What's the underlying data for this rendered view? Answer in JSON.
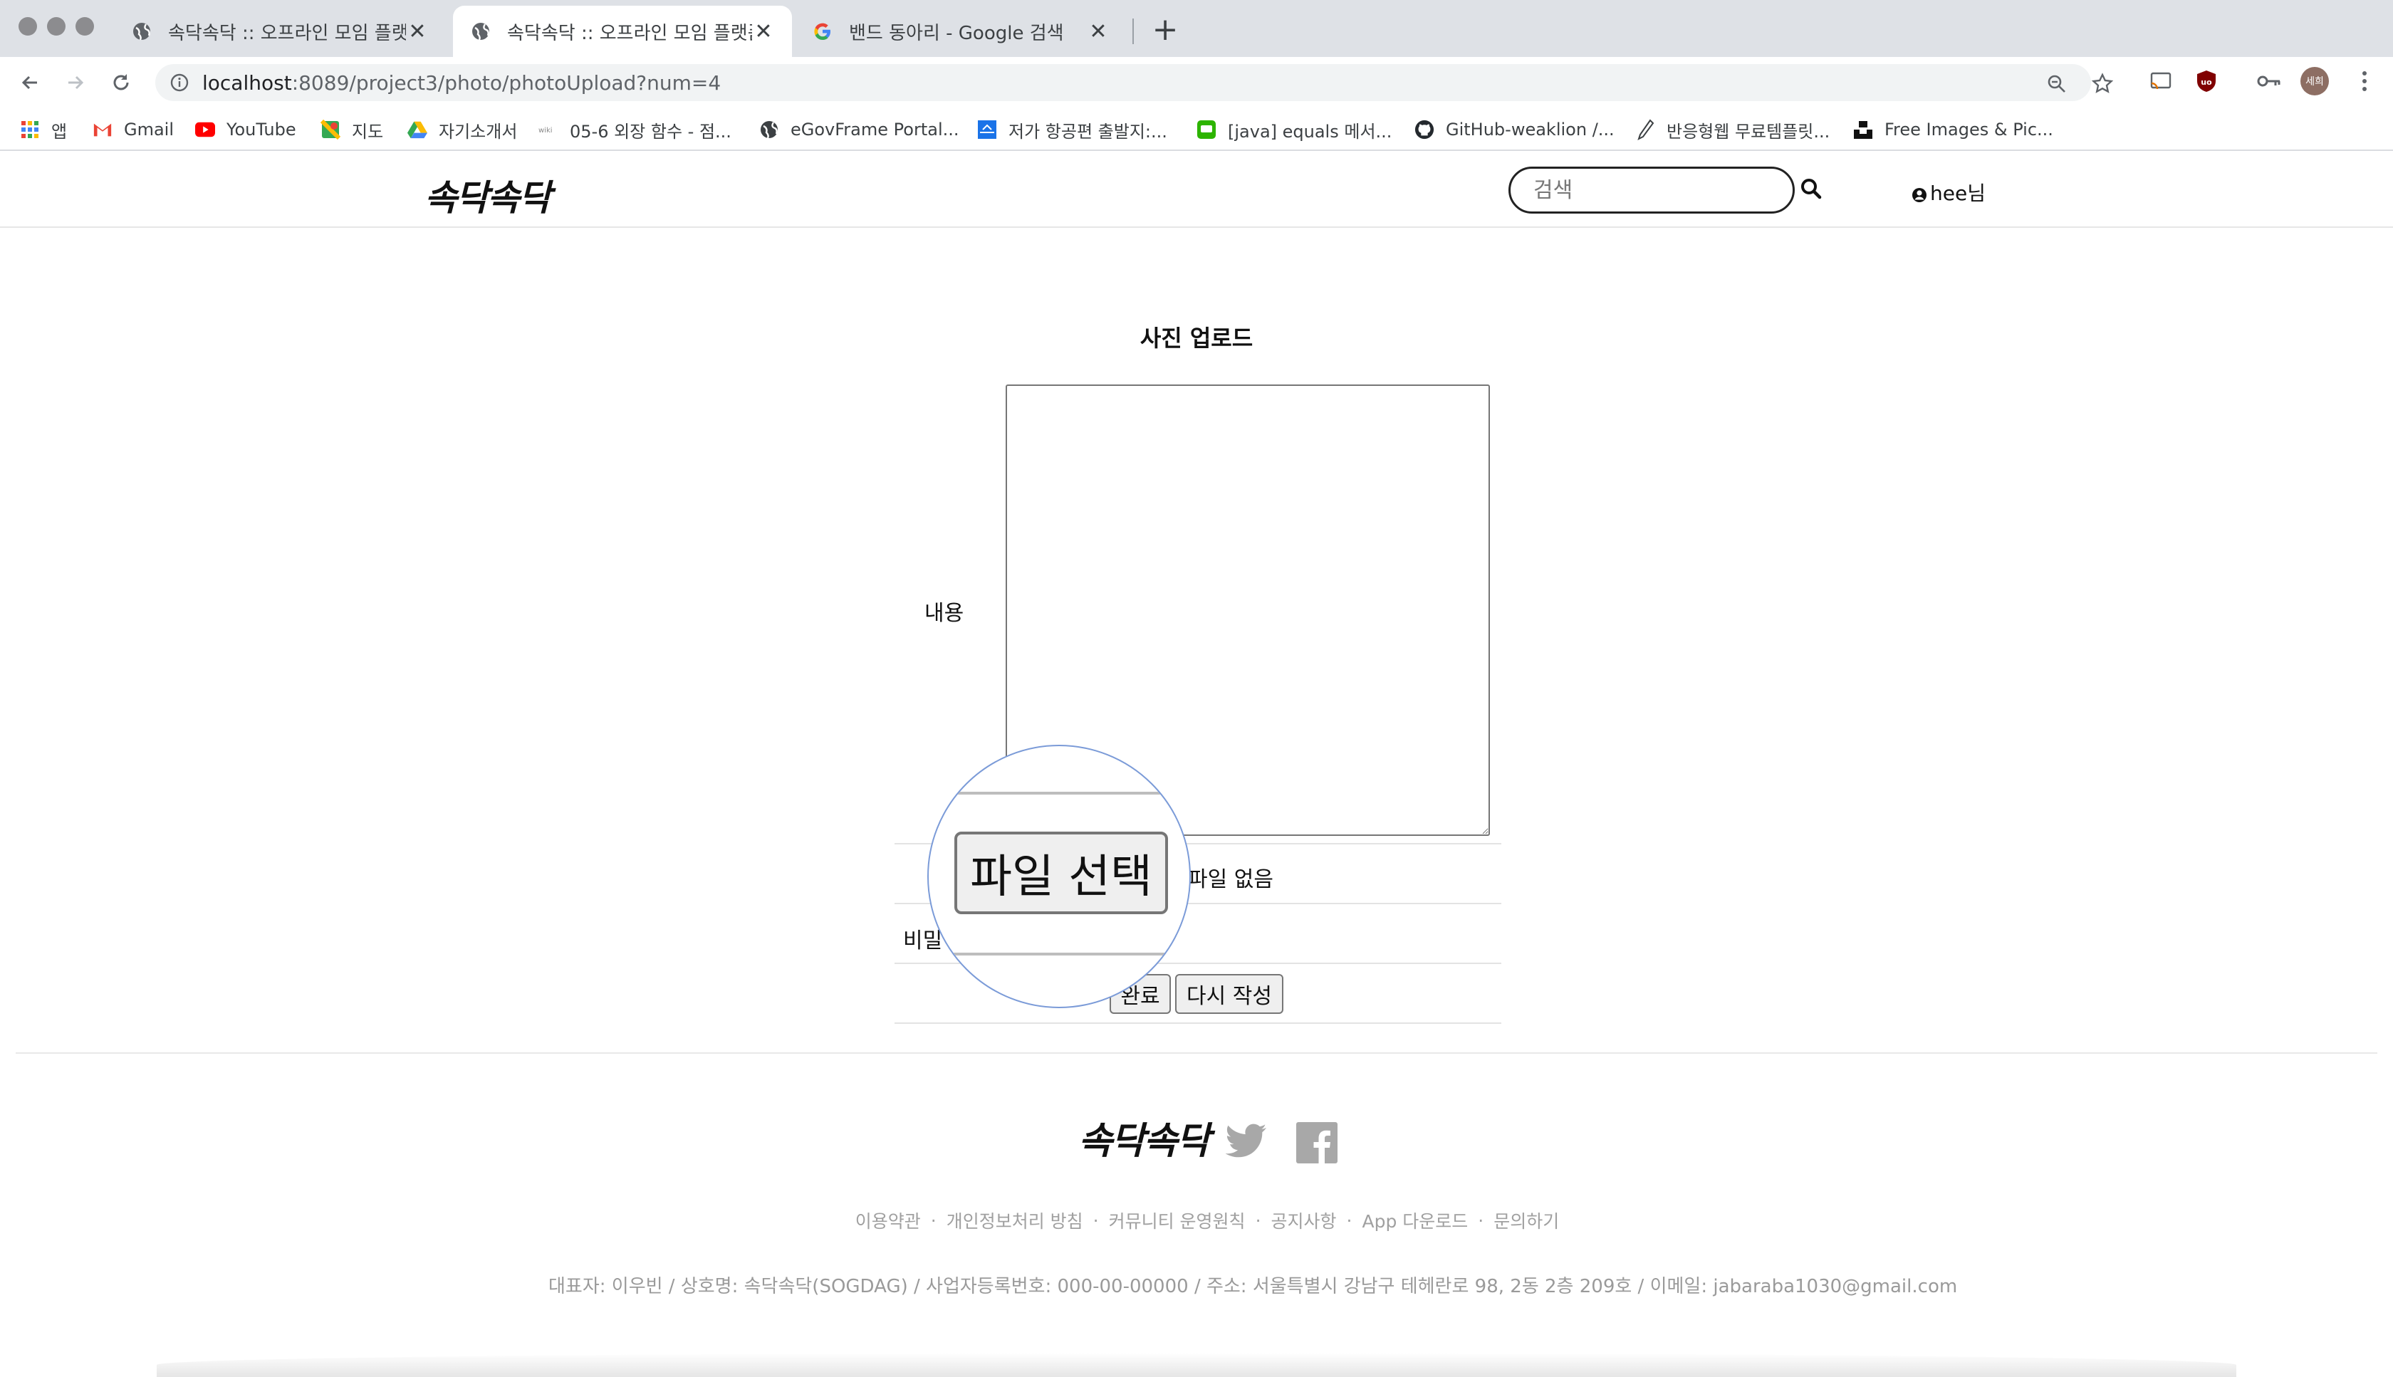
{
  "browser": {
    "tabs": [
      {
        "title": "속닥속닥 :: 오프라인 모임 플랫폼",
        "active": false,
        "icon": "globe-icon"
      },
      {
        "title": "속닥속닥 :: 오프라인 모임 플랫폼",
        "active": true,
        "icon": "globe-icon"
      },
      {
        "title": "밴드 동아리 - Google 검색",
        "active": false,
        "icon": "google-icon"
      }
    ],
    "url_host": "localhost",
    "url_path": ":8089/project3/photo/photoUpload?num=4",
    "bookmarks": [
      {
        "label": "앱",
        "icon": "apps-grid-icon"
      },
      {
        "label": "Gmail",
        "icon": "gmail-icon"
      },
      {
        "label": "YouTube",
        "icon": "youtube-icon"
      },
      {
        "label": "지도",
        "icon": "maps-icon"
      },
      {
        "label": "자기소개서",
        "icon": "drive-icon"
      },
      {
        "label": "05-6 외장 함수 - 점...",
        "icon": "wikidocs-icon"
      },
      {
        "label": "eGovFrame Portal...",
        "icon": "globe-icon"
      },
      {
        "label": "저가 항공편 출발지:...",
        "icon": "flight-icon"
      },
      {
        "label": "[java] equals 메서...",
        "icon": "chat-icon"
      },
      {
        "label": "GitHub-weaklion /...",
        "icon": "github-icon"
      },
      {
        "label": "반응형웹 무료템플릿...",
        "icon": "pen-icon"
      },
      {
        "label": "Free Images & Pic...",
        "icon": "unsplash-icon"
      }
    ],
    "profile_initials": "세희"
  },
  "site": {
    "logo": "속닥속닥",
    "search_placeholder": "검색",
    "user_label": "hee님"
  },
  "form": {
    "title": "사진 업로드",
    "content_label": "내용",
    "password_label": "비밀",
    "file_button": "파일 선택",
    "file_status": "파일 없음",
    "submit_button": "완료",
    "reset_button": "다시 작성"
  },
  "footer": {
    "logo": "속닥속닥",
    "links": [
      "이용약관",
      "개인정보처리 방침",
      "커뮤니티 운영원칙",
      "공지사항",
      "App 다운로드",
      "문의하기"
    ],
    "info": "대표자: 이우빈 / 상호명: 속닥속닥(SOGDAG) / 사업자등록번호: 000-00-00000 / 주소: 서울특별시 강남구 테헤란로 98, 2동 2층 209호 / 이메일: jabaraba1030@gmail.com"
  },
  "colors": {
    "tabstrip": "#dee1e6",
    "footer_text": "#9a9a9a",
    "magnifier_border": "#7b9bd8"
  }
}
